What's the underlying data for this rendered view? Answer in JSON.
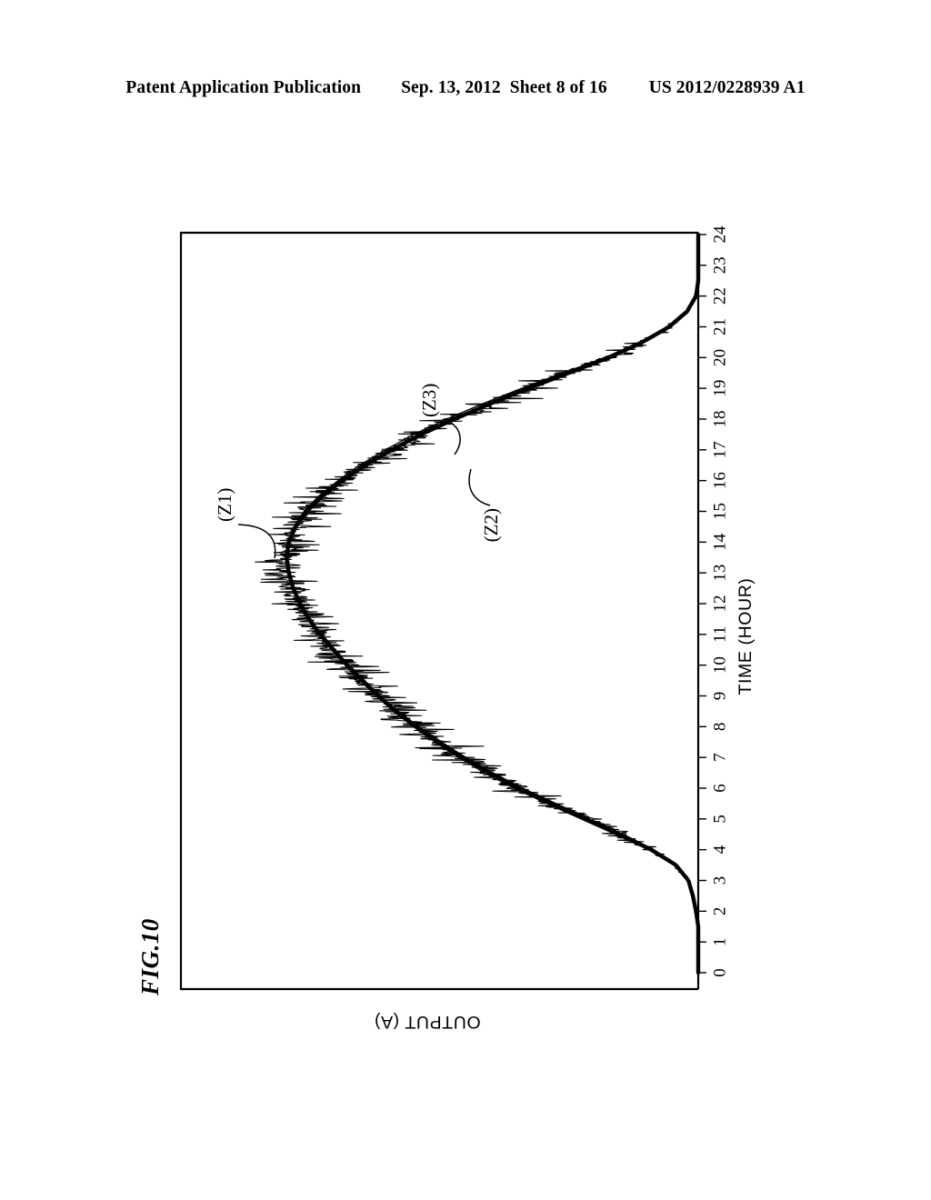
{
  "header": {
    "publication": "Patent Application Publication",
    "date": "Sep. 13, 2012",
    "sheet": "Sheet 8 of 16",
    "number": "US 2012/0228939 A1"
  },
  "figure": {
    "label": "FIG.10"
  },
  "chart_data": {
    "type": "line",
    "title": "",
    "orientation": "rotated-90-ccw",
    "xlabel": "TIME (HOUR)",
    "ylabel": "OUTPUT (A)",
    "xlim": [
      0,
      24
    ],
    "ylim": [
      0,
      1.0
    ],
    "grid": false,
    "legend": "none",
    "xticks": [
      "0",
      "1",
      "2",
      "3",
      "4",
      "5",
      "6",
      "7",
      "8",
      "9",
      "10",
      "11",
      "12",
      "13",
      "14",
      "15",
      "16",
      "17",
      "18",
      "19",
      "20",
      "21",
      "22",
      "23",
      "24"
    ],
    "yticks": [],
    "x": [
      0,
      0.5,
      1,
      1.5,
      2,
      2.5,
      3,
      3.5,
      4,
      4.5,
      5,
      5.5,
      6,
      6.5,
      7,
      7.5,
      8,
      8.5,
      9,
      9.5,
      10,
      10.5,
      11,
      11.5,
      12,
      12.5,
      13,
      13.5,
      14,
      14.5,
      15,
      15.5,
      16,
      16.5,
      17,
      17.5,
      18,
      18.5,
      19,
      19.5,
      20,
      20.5,
      21,
      21.5,
      22,
      22.5,
      23,
      23.5,
      24
    ],
    "series": [
      {
        "name": "(Z1)",
        "role": "measured-noisy-output",
        "style": "thin jagged noisy trace",
        "values": [
          0,
          0,
          0,
          0,
          0.005,
          0.012,
          0.022,
          0.05,
          0.105,
          0.175,
          0.25,
          0.325,
          0.4,
          0.465,
          0.525,
          0.58,
          0.63,
          0.675,
          0.715,
          0.75,
          0.785,
          0.815,
          0.845,
          0.87,
          0.89,
          0.905,
          0.915,
          0.92,
          0.915,
          0.9,
          0.875,
          0.84,
          0.795,
          0.745,
          0.685,
          0.62,
          0.545,
          0.465,
          0.38,
          0.29,
          0.2,
          0.125,
          0.065,
          0.025,
          0.005,
          0,
          0,
          0,
          0
        ],
        "noise_amplitude": 0.055
      },
      {
        "name": "(Z2)",
        "role": "smoothed-thick-output-curve",
        "style": "thick smooth line",
        "values": [
          0,
          0,
          0,
          0,
          0.005,
          0.012,
          0.022,
          0.05,
          0.105,
          0.175,
          0.25,
          0.325,
          0.4,
          0.465,
          0.525,
          0.58,
          0.63,
          0.675,
          0.715,
          0.75,
          0.785,
          0.815,
          0.845,
          0.87,
          0.89,
          0.905,
          0.915,
          0.92,
          0.915,
          0.9,
          0.875,
          0.84,
          0.795,
          0.745,
          0.685,
          0.62,
          0.545,
          0.465,
          0.38,
          0.29,
          0.2,
          0.125,
          0.065,
          0.025,
          0.005,
          0,
          0,
          0,
          0
        ]
      },
      {
        "name": "(Z3)",
        "role": "reference-thin-output-curve",
        "style": "thin smooth line",
        "values": [
          0,
          0,
          0,
          0,
          0.004,
          0.01,
          0.02,
          0.048,
          0.112,
          0.185,
          0.262,
          0.338,
          0.412,
          0.478,
          0.535,
          0.588,
          0.637,
          0.681,
          0.72,
          0.755,
          0.789,
          0.819,
          0.848,
          0.872,
          0.892,
          0.907,
          0.917,
          0.922,
          0.918,
          0.904,
          0.881,
          0.848,
          0.805,
          0.757,
          0.699,
          0.636,
          0.562,
          0.482,
          0.395,
          0.302,
          0.209,
          0.131,
          0.068,
          0.026,
          0.005,
          0,
          0,
          0,
          0
        ]
      }
    ],
    "annotations": [
      {
        "label": "(Z1)",
        "points_to": "noisy measured curve near hour 14 peak region"
      },
      {
        "label": "(Z2)",
        "points_to": "thick smoothed curve near hour 16"
      },
      {
        "label": "(Z3)",
        "points_to": "thin reference curve near hour 17"
      }
    ]
  }
}
